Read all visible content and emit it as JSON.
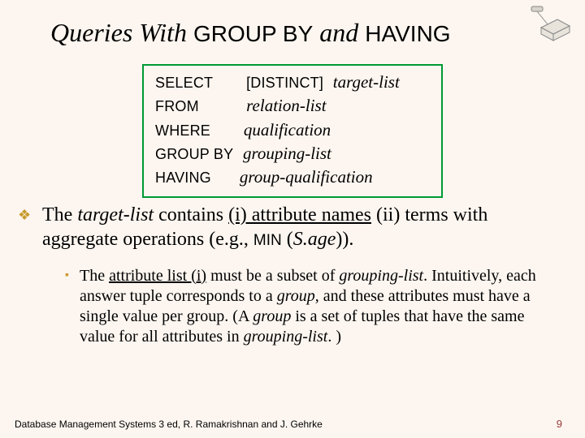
{
  "title": {
    "pre": "Queries With ",
    "kw1": "GROUP BY",
    "mid": " and ",
    "kw2": "HAVING"
  },
  "syntax": {
    "select_kw": "SELECT",
    "distinct": "[DISTINCT]",
    "target": "target-list",
    "from_kw": "FROM",
    "relation": "relation-list",
    "where_kw": "WHERE",
    "qual": "qualification",
    "group_kw": "GROUP BY",
    "grouping": "grouping-list",
    "having_kw": "HAVING",
    "groupqual": "group-qualification"
  },
  "b1": {
    "t0": "The ",
    "t1": "target-list",
    "t2": " contains ",
    "t3": "(i) attribute names",
    "t4": "  (ii) terms with aggregate operations (e.g., ",
    "min": "MIN",
    "t5": " (",
    "sage": "S.age",
    "t6": ")). "
  },
  "b2": {
    "t0": "The ",
    "t1": "attribute list (i)",
    "t2": " must be a subset of ",
    "t3": "grouping-list",
    "t4": ". Intuitively, each answer tuple corresponds to a ",
    "t5": "group",
    "t6": ", and these attributes must have a single value per group.  (A ",
    "t7": "group",
    "t8": " is a set of tuples that have the same value for all attributes in ",
    "t9": "grouping-list",
    "t10": ". )"
  },
  "footer": "Database Management Systems 3 ed,  R. Ramakrishnan and J. Gehrke",
  "page": "9"
}
